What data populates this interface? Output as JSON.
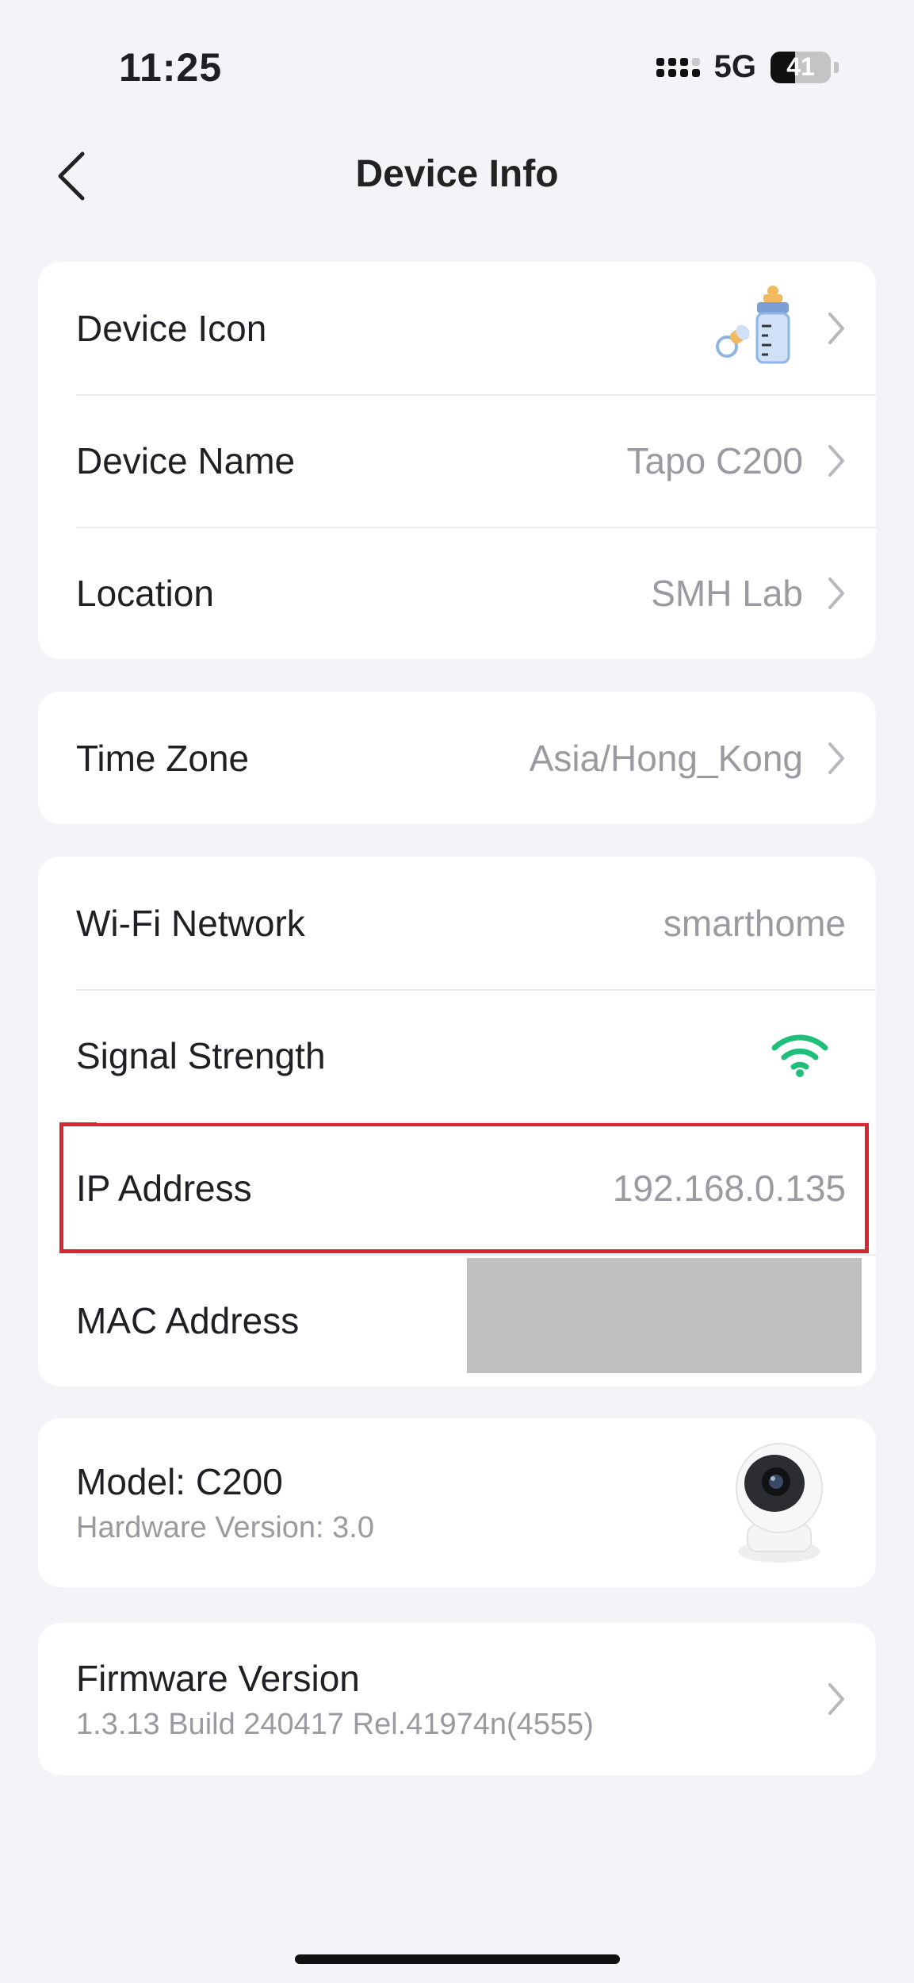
{
  "status_bar": {
    "time": "11:25",
    "network": "5G",
    "battery": "41",
    "battery_level_percent": 41
  },
  "nav": {
    "title": "Device Info"
  },
  "device_section": {
    "icon_row": {
      "label": "Device Icon",
      "icon": "baby-bottle-icon"
    },
    "name_row": {
      "label": "Device Name",
      "value": "Tapo C200"
    },
    "location_row": {
      "label": "Location",
      "value": "SMH Lab"
    }
  },
  "timezone_section": {
    "label": "Time Zone",
    "value": "Asia/Hong_Kong"
  },
  "network_section": {
    "wifi": {
      "label": "Wi-Fi Network",
      "value": "smarthome"
    },
    "signal": {
      "label": "Signal Strength",
      "icon": "wifi-signal-icon",
      "color": "#1fbf7a"
    },
    "ip": {
      "label": "IP Address",
      "value": "192.168.0.135"
    },
    "mac": {
      "label": "MAC Address"
    }
  },
  "model_section": {
    "title": "Model: C200",
    "subtitle": "Hardware Version: 3.0",
    "image": "camera-icon"
  },
  "firmware_section": {
    "title": "Firmware Version",
    "subtitle": "1.3.13 Build 240417 Rel.41974n(4555)"
  },
  "colors": {
    "background": "#f3f4f8",
    "highlight": "#d52632",
    "accent": "#1fbf7a"
  }
}
